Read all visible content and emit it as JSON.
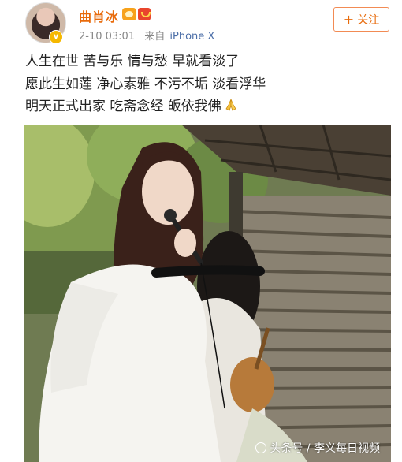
{
  "post": {
    "author": "曲肖冰",
    "time": "2-10 03:01",
    "source_label": "来自",
    "source": "iPhone X",
    "follow_label": "关注",
    "lines": [
      "人生在世 苦与乐 情与愁 早就看淡了",
      "愿此生如莲 净心素雅 不污不垢 淡看浮华",
      "明天正式出家 吃斋念经 皈依我佛"
    ]
  },
  "watermark": "头条号 / 李义每日视频",
  "colors": {
    "author": "#e86b0c",
    "source": "#4a6da7",
    "follow_border": "#f28b54"
  },
  "icons": [
    "avatar",
    "verified-badge-icon",
    "vip-badge-icon",
    "member-badge-icon",
    "plus-icon",
    "pray-hands-icon",
    "toutiao-logo-icon"
  ]
}
